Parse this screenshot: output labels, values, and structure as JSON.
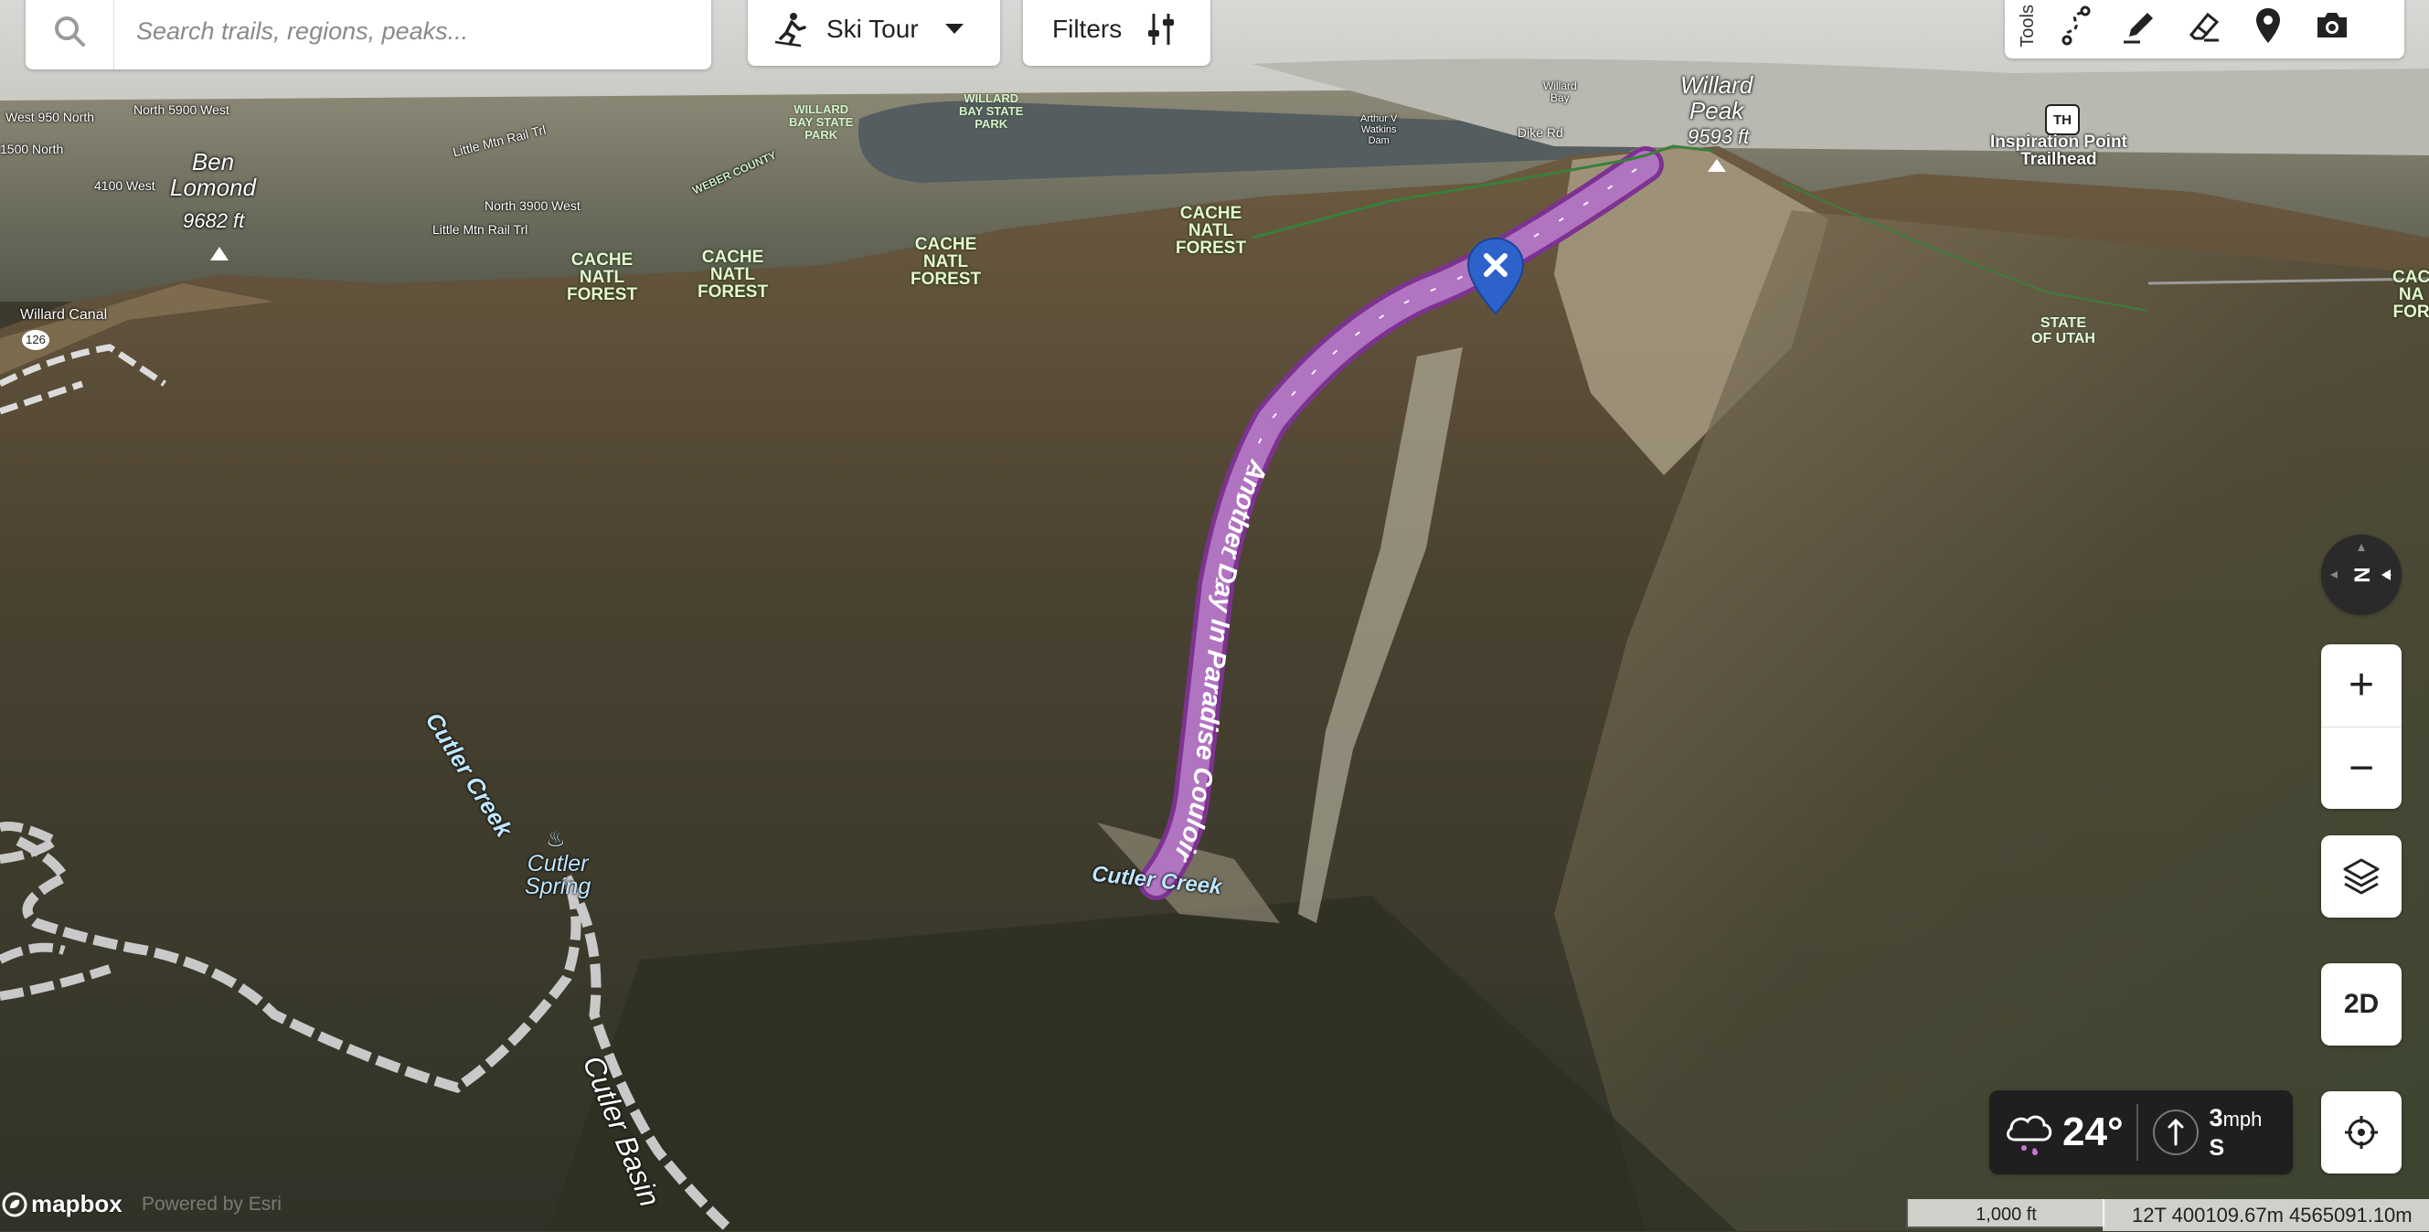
{
  "search": {
    "placeholder": "Search trails, regions, peaks..."
  },
  "activity": {
    "label": "Ski Tour",
    "icon": "ski-tour-icon"
  },
  "filters": {
    "label": "Filters",
    "icon": "sliders-icon"
  },
  "tools": {
    "label": "Tools",
    "items": [
      "route-draw-icon",
      "pencil-icon",
      "eraser-icon",
      "map-pin-icon",
      "camera-icon"
    ]
  },
  "map": {
    "peaks": [
      {
        "name": "Ben\nLomond",
        "elevation": "9682 ft"
      },
      {
        "name": "Willard\nPeak",
        "elevation": "9593 ft"
      }
    ],
    "forest_labels": [
      "CACHE\nNATL\nFOREST",
      "CACHE\nNATL\nFOREST",
      "CACHE\nNATL\nFOREST",
      "CACHE\nNATL\nFOREST",
      "CAC\nNA\nFOR"
    ],
    "parks": [
      "WILLARD\nBAY STATE\nPARK",
      "WILLARD\nBAY STATE\nPARK"
    ],
    "state_label": "STATE\nOF UTAH",
    "trailhead": {
      "badge": "TH",
      "name": "Inspiration Point\nTrailhead"
    },
    "roads": [
      "North 5900 West",
      "West 950 North",
      "1500 North",
      "Little Mtn Rail Trl",
      "4100 West",
      "North 3900 West",
      "Little Mtn Rail Trl",
      "WEBER COUNTY",
      "Dike Rd",
      "Willard\nBay",
      "Arthur V\nWatkins\nDam",
      "Willard Canal",
      "126"
    ],
    "water_labels": [
      "Cutler Creek",
      "Cutler Creek",
      "Cutler Basin"
    ],
    "spring": {
      "name": "Cutler\nSpring"
    },
    "route": {
      "name": "Another Day In Paradise Couloir",
      "color": "#8e3f9a"
    },
    "marker": {
      "icon": "close-icon",
      "color": "#2c62c9"
    }
  },
  "controls": {
    "compass": "N",
    "zoom_in": "+",
    "zoom_out": "−",
    "layers_icon": "layers-icon",
    "view_toggle": "2D",
    "locate_icon": "crosshair-icon"
  },
  "weather": {
    "temperature": "24°",
    "wind_speed": "3",
    "wind_unit": "mph",
    "wind_direction": "S"
  },
  "scale": {
    "label": "1,000 ft"
  },
  "coordinates": "12T 400109.67m 4565091.10m",
  "attribution": {
    "brand": "mapbox",
    "powered": "Powered by Esri"
  }
}
